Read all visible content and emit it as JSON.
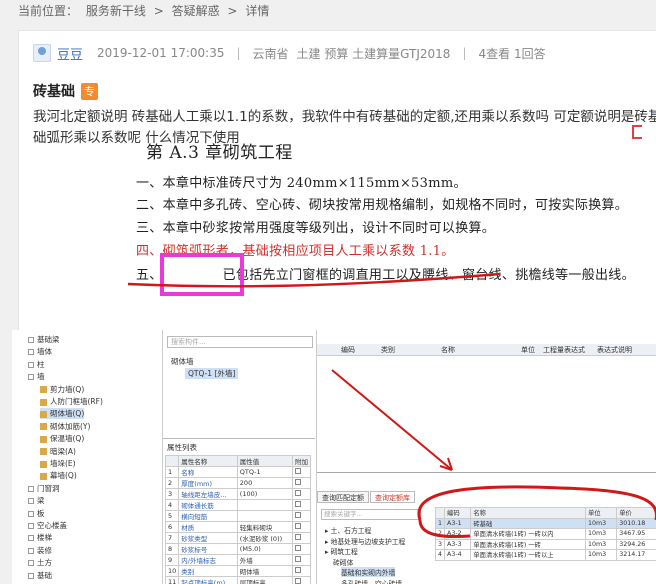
{
  "breadcrumb": {
    "label": "当前位置：",
    "items": [
      "服务新干线",
      "答疑解惑",
      "详情"
    ],
    "separator": ">"
  },
  "question": {
    "user": "豆豆",
    "datetime": "2019-12-01 17:00:35",
    "region": "云南省",
    "tags": "土建 预算 土建算量GTJ2018",
    "stats": "4查看 1回答",
    "title": "砖基础",
    "title_badge": "专",
    "body": "我河北定额说明 砖基础人工乘以1.1的系数，我软件中有砖基础的定额,还用乘以系数吗  可定额说明是砖基础弧形乘以系数呢   什么情况下使用"
  },
  "doc_image": {
    "heading": "第 A.3 章砌筑工程",
    "lines": [
      "一、本章中标准砖尺寸为 240mm×115mm×53mm。",
      "二、本章中多孔砖、空心砖、砌块按常用规格编制，如规格不同时，可按实际换算。",
      "三、本章中砂浆按常用强度等级列出，设计不同时可以换算。",
      "四、砌筑弧形者，基础按相应项目人工乘以系数 1.1。",
      "五、　　　　　已包括先立门窗框的调直用工以及腰线、窗台线、挑檐线等一般出线。"
    ],
    "line4_prefix": "四、"
  },
  "software": {
    "tree": [
      {
        "label": "基础梁",
        "level": 0
      },
      {
        "label": "墙体",
        "level": 0
      },
      {
        "label": "柱",
        "level": 0
      },
      {
        "label": "墙",
        "level": 0
      },
      {
        "label": "剪力墙(Q)",
        "level": 1
      },
      {
        "label": "人防门框墙(RF)",
        "level": 1
      },
      {
        "label": "砌体墙(Q)",
        "level": 1,
        "selected": true
      },
      {
        "label": "砌体加筋(Y)",
        "level": 1
      },
      {
        "label": "保温墙(Q)",
        "level": 1
      },
      {
        "label": "暗梁(A)",
        "level": 1
      },
      {
        "label": "墙垛(E)",
        "level": 1
      },
      {
        "label": "幕墙(Q)",
        "level": 1
      },
      {
        "label": "门窗洞",
        "level": 0
      },
      {
        "label": "梁",
        "level": 0
      },
      {
        "label": "板",
        "level": 0
      },
      {
        "label": "空心楼盖",
        "level": 0
      },
      {
        "label": "楼梯",
        "level": 0
      },
      {
        "label": "装修",
        "level": 0
      },
      {
        "label": "土方",
        "level": 0
      },
      {
        "label": "基础",
        "level": 0
      }
    ],
    "component_search": "搜索构件...",
    "component_group": "砌体墙",
    "component_item": "QTQ-1 [外墙]",
    "prop_header": "属性列表",
    "prop_cols": [
      "属性名称",
      "属性值",
      "附加"
    ],
    "props": [
      [
        "名称",
        "QTQ-1"
      ],
      [
        "厚度(mm)",
        "200"
      ],
      [
        "轴线距左墙皮...",
        "(100)"
      ],
      [
        "砌体通长筋",
        ""
      ],
      [
        "横向短筋",
        ""
      ],
      [
        "材质",
        "轻集料砌块"
      ],
      [
        "砂浆类型",
        "(水泥砂浆 (0))"
      ],
      [
        "砂浆标号",
        "(M5.0)"
      ],
      [
        "内/外墙标志",
        "外墙"
      ],
      [
        "类别",
        "砌体墙"
      ],
      [
        "起点顶标高(m)",
        "层顶标高"
      ]
    ],
    "code_header": [
      "编码",
      "类别",
      "名称",
      "单位",
      "工程量表达式",
      "表达式说明"
    ],
    "tabs": [
      "查询匹配定额",
      "查询定额库"
    ],
    "quota_search": "搜索关键字...",
    "quota_tree": [
      "土、石方工程",
      "地基处理与边坡支护工程",
      "砌筑工程",
      "砖砌体",
      "基础和实砌内外墙",
      "多孔砖墙、空心砖墙"
    ],
    "quota_cols": [
      "编码",
      "名称",
      "单位",
      "单价"
    ],
    "quota_rows": [
      [
        "A3-1",
        "砖基础",
        "10m3",
        "3010.18"
      ],
      [
        "A3-2",
        "单面清水砖墙(1砖) 一砖以内",
        "10m3",
        "3467.95"
      ],
      [
        "A3-3",
        "单面清水砖墙(1砖) 一砖",
        "10m3",
        "3294.26"
      ],
      [
        "A3-4",
        "单面清水砖墙(1砖) 一砖以上",
        "10m3",
        "3214.17"
      ]
    ]
  },
  "colors": {
    "link": "#2b6cc4",
    "highlight_red": "#d0302d",
    "annotation_pink": "#e83ad8",
    "annotation_red": "#d01818",
    "badge_orange": "#f08c2e"
  }
}
